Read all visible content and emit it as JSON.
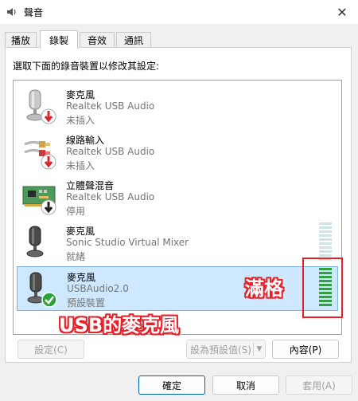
{
  "window": {
    "title": "聲音"
  },
  "tabs": [
    {
      "label": "播放"
    },
    {
      "label": "錄製"
    },
    {
      "label": "音效"
    },
    {
      "label": "通訊"
    }
  ],
  "instruction": "選取下面的錄音裝置以修改其設定:",
  "devices": [
    {
      "name": "麥克風",
      "driver": "Realtek USB Audio",
      "status": "未插入",
      "icon": "microphone-icon",
      "badge": "unplugged-arrow-icon"
    },
    {
      "name": "線路輸入",
      "driver": "Realtek USB Audio",
      "status": "未插入",
      "icon": "line-in-cable-icon",
      "badge": "unplugged-arrow-icon"
    },
    {
      "name": "立體聲混音",
      "driver": "Realtek USB Audio",
      "status": "停用",
      "icon": "sound-card-icon",
      "badge": "disabled-arrow-icon"
    },
    {
      "name": "麥克風",
      "driver": "Sonic Studio Virtual Mixer",
      "status": "就緒",
      "icon": "microphone-icon",
      "badge": ""
    },
    {
      "name": "麥克風",
      "driver": "USBAudio2.0",
      "status": "預設裝置",
      "icon": "microphone-icon",
      "badge": "default-check-icon"
    }
  ],
  "meters": [
    {
      "device_index": 3,
      "level": 0.0
    },
    {
      "device_index": 4,
      "level": 1.0
    }
  ],
  "annotations": {
    "full_label": "滿格",
    "usb_label": "USB的麥克風",
    "color": "#e8202a"
  },
  "buttons": {
    "configure": "設定(C)",
    "set_default": "設為預設值(S)",
    "properties": "內容(P)",
    "ok": "確定",
    "cancel": "取消",
    "apply": "套用(A)"
  },
  "colors": {
    "selection": "#cde8ff",
    "meter_on": "#2fa23a",
    "meter_off": "#cfe3ea",
    "badge_red": "#d9262b",
    "badge_green": "#2aa33b"
  }
}
